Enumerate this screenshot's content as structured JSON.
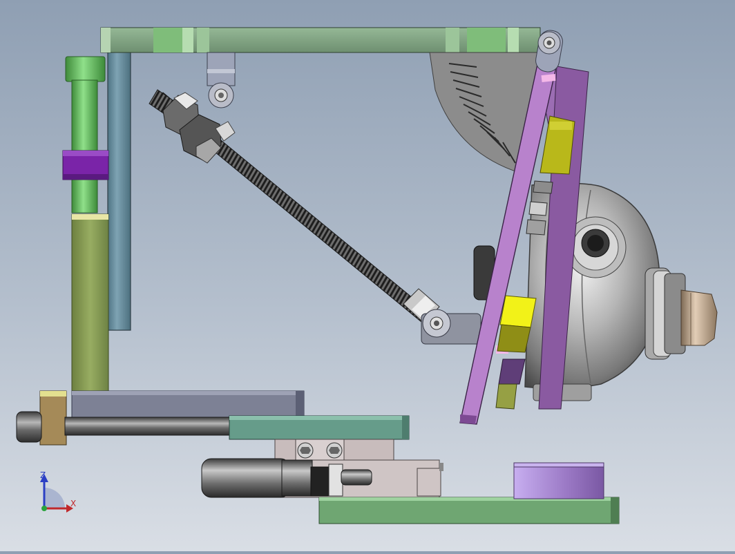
{
  "view": {
    "title": "",
    "background_top": "#8f9fb3",
    "background_bottom": "#d9dee5"
  },
  "triad": {
    "z_label": "Z",
    "x_label": "X",
    "z_color": "#2b3fc4",
    "x_color": "#c0282b",
    "y_color": "#2aa33c"
  },
  "parts": [
    {
      "id": "top-frame-bar",
      "color": "#84a886"
    },
    {
      "id": "vertical-post",
      "color": "#6a8fa0"
    },
    {
      "id": "guide-rod",
      "color": "#5fbf5a"
    },
    {
      "id": "collar",
      "color": "#7a24a8"
    },
    {
      "id": "column-block",
      "color": "#8ea55a"
    },
    {
      "id": "base-beam",
      "color": "#7a7f95"
    },
    {
      "id": "lead-screw",
      "color": "#5a5a5a"
    },
    {
      "id": "index-plate",
      "color": "#8a8a8a"
    },
    {
      "id": "mounting-plate",
      "color": "#b07ec4"
    },
    {
      "id": "jaw-pads",
      "color": "#c4c212"
    },
    {
      "id": "spherical-housing",
      "color": "#a8a8a8"
    },
    {
      "id": "nozzle",
      "color": "#c8b29a"
    },
    {
      "id": "clamp-slide",
      "color": "#669c8a"
    },
    {
      "id": "cylinder",
      "color": "#8a8a8a"
    },
    {
      "id": "base-plate",
      "color": "#6fa672"
    },
    {
      "id": "support-puck",
      "color": "#a07cc8"
    }
  ]
}
